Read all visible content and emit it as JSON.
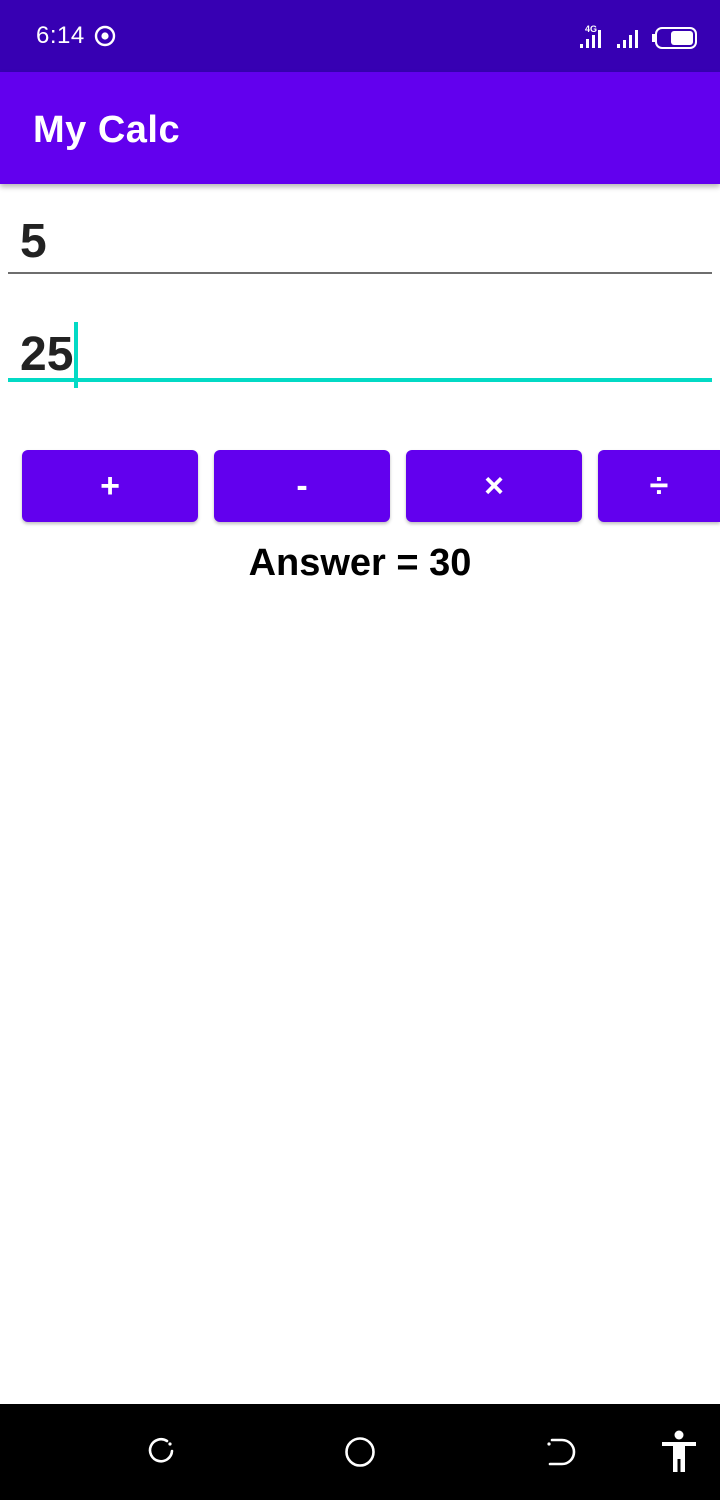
{
  "status_bar": {
    "time": "6:14",
    "network_type": "4G",
    "icons": [
      "focus-mode-icon",
      "signal-4g-icon",
      "signal-icon",
      "battery-icon"
    ]
  },
  "app_bar": {
    "title": "My Calc"
  },
  "inputs": {
    "first_number": "5",
    "second_number": "25"
  },
  "operations": {
    "add": "+",
    "subtract": "-",
    "multiply": "×",
    "divide": "÷"
  },
  "result": {
    "text": "Answer = 30"
  },
  "navigation": {
    "icons": [
      "recents-icon",
      "home-icon",
      "back-icon",
      "accessibility-icon"
    ]
  },
  "colors": {
    "status_bar": "#3700b3",
    "primary": "#6200ee",
    "accent": "#03dac5",
    "nav_bar": "#000000"
  }
}
